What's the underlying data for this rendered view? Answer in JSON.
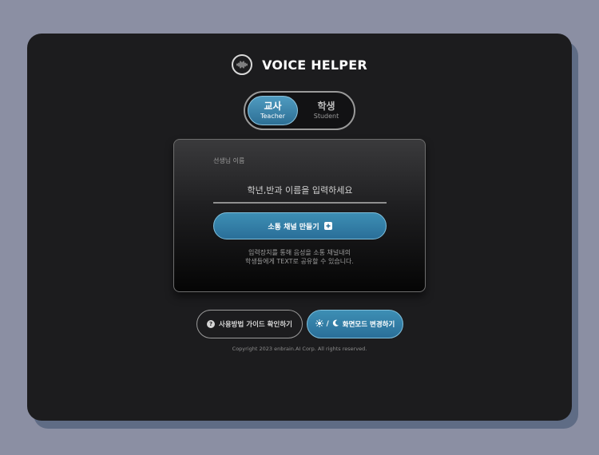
{
  "brand": {
    "title": "VOICE HELPER",
    "logo_icon": "soundwave-icon"
  },
  "role_toggle": {
    "selected": "teacher",
    "options": [
      {
        "id": "teacher",
        "ko": "교사",
        "en": "Teacher"
      },
      {
        "id": "student",
        "ko": "학생",
        "en": "Student"
      }
    ]
  },
  "form": {
    "name_label": "선생님 이름",
    "name_placeholder": "학년,반과 이름을 입력하세요",
    "name_value": "",
    "create_button_label": "소통 채널 만들기",
    "create_button_icon": "plus-square-icon",
    "hint_line1": "입력장치를 통해 음성을 소통 채널내의",
    "hint_line2": "학생들에게 TEXT로 공유할 수 있습니다."
  },
  "footer_buttons": {
    "guide_label": "사용방법 가이드 확인하기",
    "guide_icon": "question-circle-icon",
    "theme_label": "화면모드 변경하기",
    "theme_icons": [
      "sun-icon",
      "moon-icon"
    ],
    "theme_separator": "/"
  },
  "copyright": "Copyright 2023 enbrain.AI Corp. All rights reserved.",
  "colors": {
    "background": "#8b8fa3",
    "window": "#1c1c1e",
    "accent": "#3d8eb4",
    "accent_border": "#7fbfdc"
  }
}
